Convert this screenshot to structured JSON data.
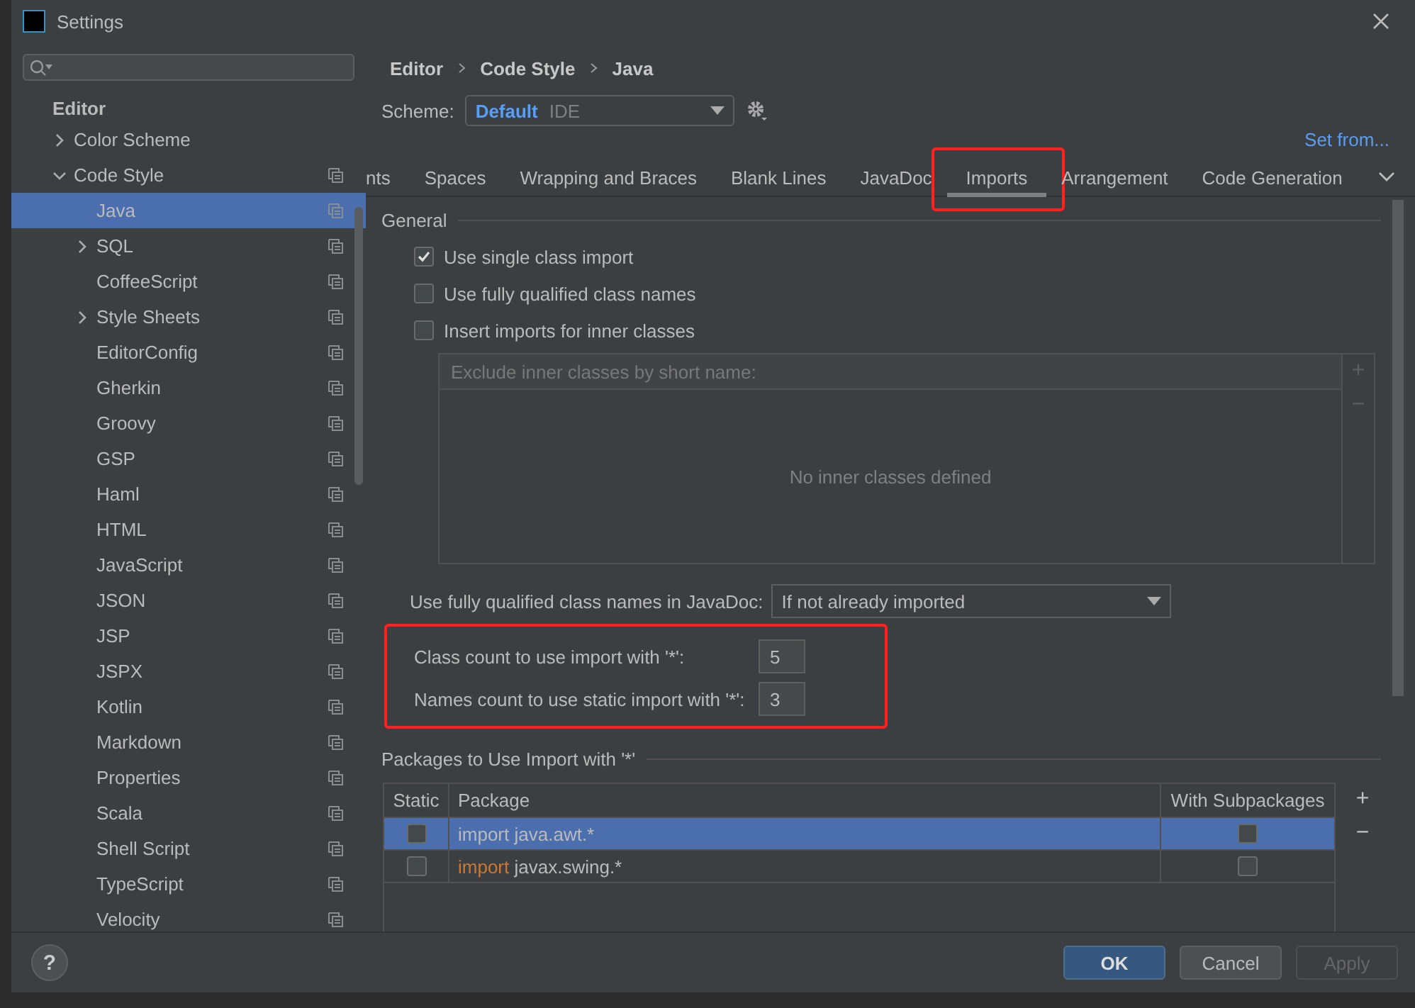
{
  "window": {
    "title": "Settings"
  },
  "sidebar": {
    "heading": "Editor",
    "items": [
      {
        "label": "Color Scheme",
        "expanded": false,
        "has_children": true,
        "selected": false,
        "copyable": false
      },
      {
        "label": "Code Style",
        "expanded": true,
        "has_children": true,
        "selected": false,
        "copyable": true,
        "children": [
          {
            "label": "Java",
            "selected": true,
            "has_children": false,
            "copyable": true
          },
          {
            "label": "SQL",
            "selected": false,
            "has_children": true,
            "expanded": false,
            "copyable": true
          },
          {
            "label": "CoffeeScript",
            "selected": false,
            "has_children": false,
            "copyable": true
          },
          {
            "label": "Style Sheets",
            "selected": false,
            "has_children": true,
            "expanded": false,
            "copyable": true
          },
          {
            "label": "EditorConfig",
            "selected": false,
            "has_children": false,
            "copyable": true
          },
          {
            "label": "Gherkin",
            "selected": false,
            "has_children": false,
            "copyable": true
          },
          {
            "label": "Groovy",
            "selected": false,
            "has_children": false,
            "copyable": true
          },
          {
            "label": "GSP",
            "selected": false,
            "has_children": false,
            "copyable": true
          },
          {
            "label": "Haml",
            "selected": false,
            "has_children": false,
            "copyable": true
          },
          {
            "label": "HTML",
            "selected": false,
            "has_children": false,
            "copyable": true
          },
          {
            "label": "JavaScript",
            "selected": false,
            "has_children": false,
            "copyable": true
          },
          {
            "label": "JSON",
            "selected": false,
            "has_children": false,
            "copyable": true
          },
          {
            "label": "JSP",
            "selected": false,
            "has_children": false,
            "copyable": true
          },
          {
            "label": "JSPX",
            "selected": false,
            "has_children": false,
            "copyable": true
          },
          {
            "label": "Kotlin",
            "selected": false,
            "has_children": false,
            "copyable": true
          },
          {
            "label": "Markdown",
            "selected": false,
            "has_children": false,
            "copyable": true
          },
          {
            "label": "Properties",
            "selected": false,
            "has_children": false,
            "copyable": true
          },
          {
            "label": "Scala",
            "selected": false,
            "has_children": false,
            "copyable": true
          },
          {
            "label": "Shell Script",
            "selected": false,
            "has_children": false,
            "copyable": true
          },
          {
            "label": "TypeScript",
            "selected": false,
            "has_children": false,
            "copyable": true
          },
          {
            "label": "Velocity",
            "selected": false,
            "has_children": false,
            "copyable": true
          }
        ]
      }
    ]
  },
  "breadcrumb": [
    "Editor",
    "Code Style",
    "Java"
  ],
  "scheme": {
    "label": "Scheme:",
    "name": "Default",
    "type": "IDE"
  },
  "set_from": "Set from...",
  "tabs": [
    {
      "label": "nts",
      "selected": false
    },
    {
      "label": "Spaces",
      "selected": false
    },
    {
      "label": "Wrapping and Braces",
      "selected": false
    },
    {
      "label": "Blank Lines",
      "selected": false
    },
    {
      "label": "JavaDoc",
      "selected": false
    },
    {
      "label": "Imports",
      "selected": true,
      "highlighted": true
    },
    {
      "label": "Arrangement",
      "selected": false
    },
    {
      "label": "Code Generation",
      "selected": false
    }
  ],
  "general": {
    "title": "General",
    "options": [
      {
        "label": "Use single class import",
        "checked": true
      },
      {
        "label": "Use fully qualified class names",
        "checked": false
      },
      {
        "label": "Insert imports for inner classes",
        "checked": false
      }
    ],
    "exclude_table": {
      "placeholder": "Exclude inner classes by short name:",
      "empty_text": "No inner classes defined",
      "add": "+",
      "remove": "−"
    },
    "javadoc": {
      "label": "Use fully qualified class names in JavaDoc:",
      "value": "If not already imported"
    },
    "counts_highlighted": true,
    "counts": [
      {
        "label": "Class count to use import with '*':",
        "value": "5"
      },
      {
        "label": "Names count to use static import with '*':",
        "value": "3"
      }
    ]
  },
  "packages": {
    "title": "Packages to Use Import with '*'",
    "columns": [
      "Static",
      "Package",
      "With Subpackages"
    ],
    "add": "+",
    "remove": "−",
    "rows": [
      {
        "static": false,
        "keyword": "import",
        "name": "java.awt.*",
        "with_subpackages": false,
        "selected": true
      },
      {
        "static": false,
        "keyword": "import",
        "name": "javax.swing.*",
        "with_subpackages": false,
        "selected": false
      }
    ]
  },
  "help": "?",
  "buttons": [
    {
      "label": "OK",
      "kind": "default",
      "disabled": false
    },
    {
      "label": "Cancel",
      "kind": "normal",
      "disabled": false
    },
    {
      "label": "Apply",
      "kind": "normal",
      "disabled": true
    }
  ]
}
